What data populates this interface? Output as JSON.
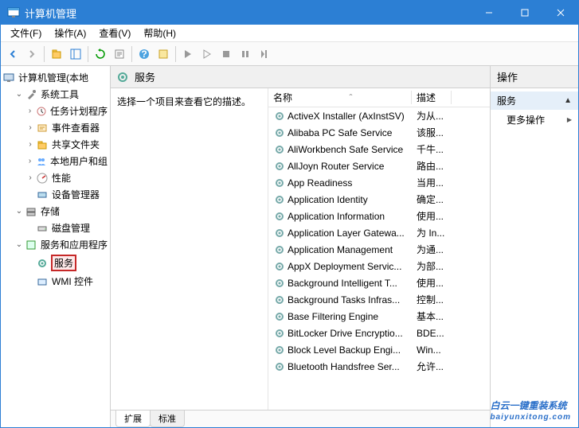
{
  "window": {
    "title": "计算机管理"
  },
  "menu": {
    "file": "文件(F)",
    "action": "操作(A)",
    "view": "查看(V)",
    "help": "帮助(H)"
  },
  "tree": {
    "root": "计算机管理(本地",
    "systools": "系统工具",
    "taskScheduler": "任务计划程序",
    "eventViewer": "事件查看器",
    "sharedFolders": "共享文件夹",
    "localUsers": "本地用户和组",
    "performance": "性能",
    "deviceManager": "设备管理器",
    "storage": "存储",
    "diskMgmt": "磁盘管理",
    "servicesApps": "服务和应用程序",
    "services": "服务",
    "wmi": "WMI 控件"
  },
  "center": {
    "title": "服务",
    "prompt": "选择一个项目来查看它的描述。",
    "colName": "名称",
    "colDesc": "描述",
    "tabExtended": "扩展",
    "tabStandard": "标准"
  },
  "services": [
    {
      "name": "ActiveX Installer (AxInstSV)",
      "desc": "为从..."
    },
    {
      "name": "Alibaba PC Safe Service",
      "desc": "该服..."
    },
    {
      "name": "AliWorkbench Safe Service",
      "desc": "千牛..."
    },
    {
      "name": "AllJoyn Router Service",
      "desc": "路由..."
    },
    {
      "name": "App Readiness",
      "desc": "当用..."
    },
    {
      "name": "Application Identity",
      "desc": "确定..."
    },
    {
      "name": "Application Information",
      "desc": "使用..."
    },
    {
      "name": "Application Layer Gatewa...",
      "desc": "为 In..."
    },
    {
      "name": "Application Management",
      "desc": "为通..."
    },
    {
      "name": "AppX Deployment Servic...",
      "desc": "为部..."
    },
    {
      "name": "Background Intelligent T...",
      "desc": "使用..."
    },
    {
      "name": "Background Tasks Infras...",
      "desc": "控制..."
    },
    {
      "name": "Base Filtering Engine",
      "desc": "基本..."
    },
    {
      "name": "BitLocker Drive Encryptio...",
      "desc": "BDE..."
    },
    {
      "name": "Block Level Backup Engi...",
      "desc": "Win..."
    },
    {
      "name": "Bluetooth Handsfree Ser...",
      "desc": "允许..."
    }
  ],
  "actions": {
    "title": "操作",
    "section": "服务",
    "moreActions": "更多操作"
  },
  "watermark": {
    "main": "白云一键重装系统",
    "sub": "baiyunxitong.com"
  }
}
